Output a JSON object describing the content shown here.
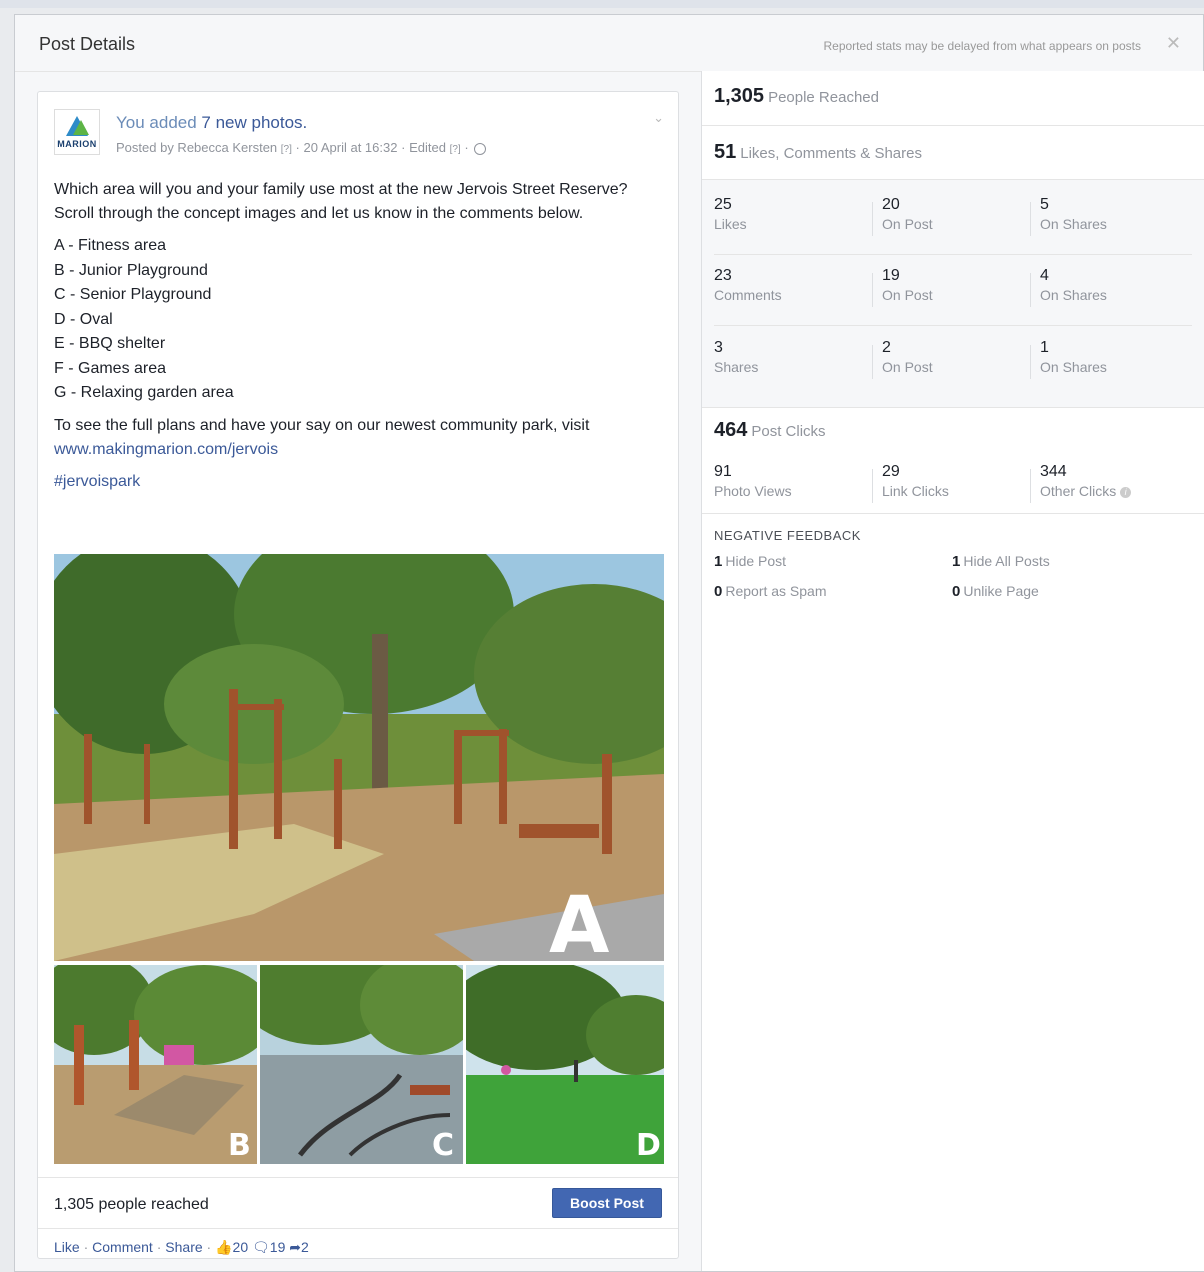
{
  "dialog": {
    "title": "Post Details",
    "note": "Reported stats may be delayed from what appears on posts",
    "close_symbol": "✕"
  },
  "post": {
    "page_logo_text": "MARION",
    "headline_prefix": "You added ",
    "headline_link": "7 new photos.",
    "posted_by": "Posted by Rebecca Kersten",
    "posted_by_help": "[?]",
    "date": "20 April at 16:32",
    "edited": "Edited",
    "edited_help": "[?]",
    "intro": "Which area will you and your family use most at the new Jervois Street Reserve? Scroll through the concept images and let us know in the comments below.",
    "options": [
      "A - Fitness area",
      "B - Junior Playground",
      "C - Senior Playground",
      "D - Oval",
      "E - BBQ shelter",
      "F - Games area",
      "G - Relaxing garden area"
    ],
    "outro_text": "To see the full plans and have your say on our newest community park, visit ",
    "outro_link": "www.makingmarion.com/jervois",
    "hashtag": "#jervoispark",
    "photo_letters": [
      "A",
      "B",
      "C",
      "D"
    ],
    "reach_text": "1,305 people reached",
    "boost_label": "Boost Post",
    "actions": {
      "like": "Like",
      "comment": "Comment",
      "share": "Share",
      "like_count": "20",
      "comment_count": "19",
      "share_count": "2"
    }
  },
  "stats": {
    "reached": {
      "value": "1,305",
      "label": "People Reached"
    },
    "engagement": {
      "value": "51",
      "label": "Likes, Comments & Shares"
    },
    "rows": [
      {
        "total": "25",
        "total_label": "Likes",
        "on_post": "20",
        "on_post_label": "On Post",
        "on_shares": "5",
        "on_shares_label": "On Shares"
      },
      {
        "total": "23",
        "total_label": "Comments",
        "on_post": "19",
        "on_post_label": "On Post",
        "on_shares": "4",
        "on_shares_label": "On Shares"
      },
      {
        "total": "3",
        "total_label": "Shares",
        "on_post": "2",
        "on_post_label": "On Post",
        "on_shares": "1",
        "on_shares_label": "On Shares"
      }
    ],
    "clicks": {
      "value": "464",
      "label": "Post Clicks",
      "items": [
        {
          "value": "91",
          "label": "Photo Views"
        },
        {
          "value": "29",
          "label": "Link Clicks"
        },
        {
          "value": "344",
          "label": "Other Clicks"
        }
      ]
    },
    "negative": {
      "title": "NEGATIVE FEEDBACK",
      "items": [
        {
          "value": "1",
          "label": "Hide Post"
        },
        {
          "value": "1",
          "label": "Hide All Posts"
        },
        {
          "value": "0",
          "label": "Report as Spam"
        },
        {
          "value": "0",
          "label": "Unlike Page"
        }
      ]
    }
  }
}
